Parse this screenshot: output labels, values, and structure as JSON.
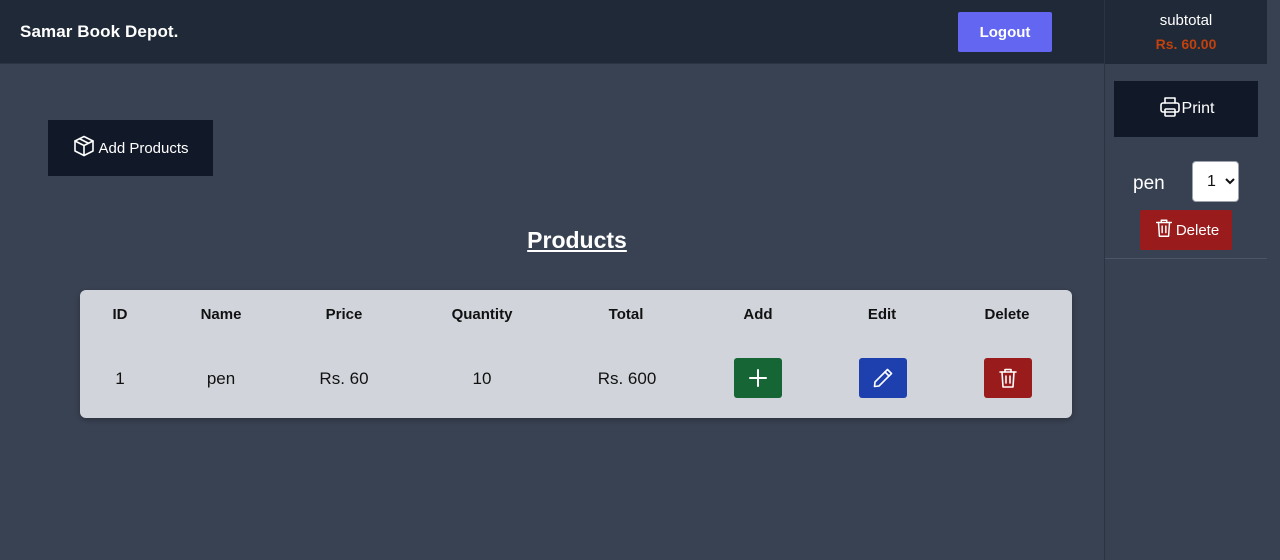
{
  "header": {
    "brand": "Samar Book Depot.",
    "logout_label": "Logout"
  },
  "main": {
    "add_products_label": "Add Products",
    "products_title": "Products",
    "table": {
      "columns": [
        "ID",
        "Name",
        "Price",
        "Quantity",
        "Total",
        "Add",
        "Edit",
        "Delete"
      ],
      "rows": [
        {
          "id": "1",
          "name": "pen",
          "price": "Rs. 60",
          "quantity": "10",
          "total": "Rs. 600"
        }
      ]
    }
  },
  "sidebar": {
    "subtotal_label": "subtotal",
    "subtotal_value": "Rs. 60.00",
    "print_label": "Print",
    "cart_items": [
      {
        "name": "pen",
        "qty": "1",
        "delete_label": "Delete"
      }
    ]
  },
  "icons": {
    "add_products": "box-icon",
    "print": "printer-icon",
    "add": "plus-icon",
    "edit": "pencil-icon",
    "delete": "trash-icon"
  },
  "colors": {
    "logout": "#6366f1",
    "add_button": "#166534",
    "edit_button": "#1e40af",
    "delete_button": "#991b1b",
    "subtotal_value": "#c2410c"
  }
}
